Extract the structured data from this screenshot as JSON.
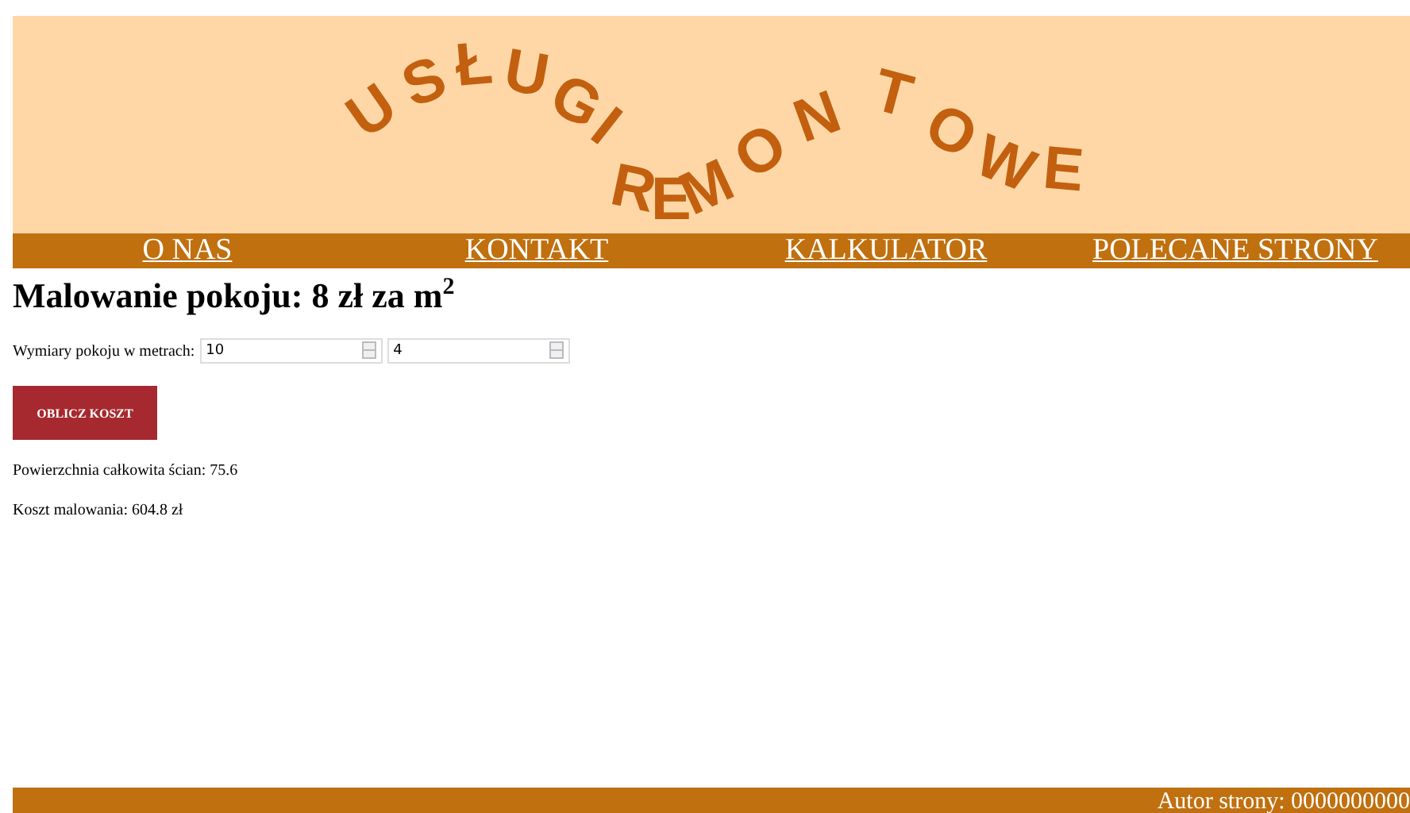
{
  "header": {
    "logo": "USŁUGI REMONTOWE"
  },
  "nav": [
    {
      "label": "O NAS"
    },
    {
      "label": "KONTAKT"
    },
    {
      "label": "KALKULATOR"
    },
    {
      "label": "POLECANE STRONY"
    }
  ],
  "heading": "Malowanie pokoju: 8 zł za m$^{2}$",
  "form": {
    "label": "Wymiary pokoju w metrach:",
    "fields": [
      {
        "value": "10"
      },
      {
        "value": "4"
      }
    ],
    "button": "OBLICZ KOSZT"
  },
  "results": [
    "Powierzchnia całkowita ścian: 75.6",
    "Koszt malowania: 604.8 zł"
  ],
  "footer": {
    "text": "Autor strony: 0000000000"
  }
}
